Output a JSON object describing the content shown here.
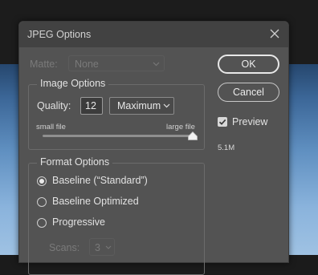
{
  "window": {
    "title": "JPEG Options"
  },
  "matte": {
    "label": "Matte:",
    "value": "None"
  },
  "image_options": {
    "title": "Image Options",
    "quality_label": "Quality:",
    "quality_value": "12",
    "quality_preset": "Maximum",
    "slider_min_label": "small file",
    "slider_max_label": "large file",
    "slider_level": 1.0
  },
  "format_options": {
    "title": "Format Options",
    "options": [
      {
        "label": "Baseline (“Standard”)",
        "selected": true
      },
      {
        "label": "Baseline Optimized",
        "selected": false
      },
      {
        "label": "Progressive",
        "selected": false
      }
    ],
    "scans_label": "Scans:",
    "scans_value": "3"
  },
  "buttons": {
    "ok": "OK",
    "cancel": "Cancel"
  },
  "preview": {
    "label": "Preview",
    "checked": true,
    "file_size": "5.1M"
  },
  "icons": [
    "close-icon",
    "chevron-down-icon",
    "slider-thumb-icon",
    "checkmark-icon"
  ]
}
